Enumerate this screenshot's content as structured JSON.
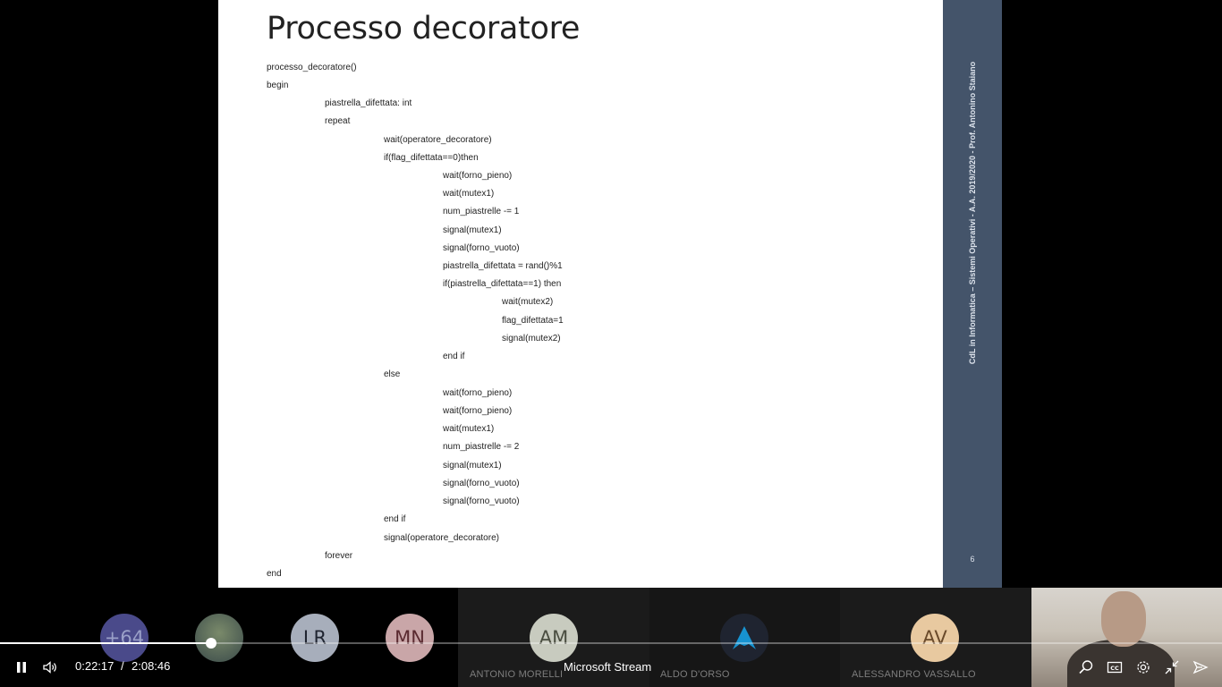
{
  "slide": {
    "title": "Processo decoratore",
    "lines": [
      "processo_decoratore()",
      "begin",
      "piastrella_difettata: int",
      "repeat",
      "wait(operatore_decoratore)",
      "if(flag_difettata==0)then",
      "wait(forno_pieno)",
      "wait(mutex1)",
      "num_piastrelle -= 1",
      "signal(mutex1)",
      "signal(forno_vuoto)",
      "piastrella_difettata = rand()%1",
      "if(piastrella_difettata==1) then",
      "wait(mutex2)",
      "flag_difettata=1",
      "signal(mutex2)",
      "end if",
      "else",
      "wait(forno_pieno)",
      "wait(forno_pieno)",
      "wait(mutex1)",
      "num_piastrelle -= 2",
      "signal(mutex1)",
      "signal(forno_vuoto)",
      "signal(forno_vuoto)",
      "end if",
      "signal(operatore_decoratore)",
      "forever",
      "end"
    ],
    "side_caption": "CdL in Informatica – Sistemi Operativi - A.A. 2019/2020 - Prof. Antonino Staiano",
    "page_number": "6",
    "band_color": "#44546a"
  },
  "participants": [
    {
      "initials": "+64",
      "name": "",
      "color": "#4a4a8a"
    },
    {
      "initials": "",
      "name": "",
      "color": "#5a6a6a"
    },
    {
      "initials": "LR",
      "name": "",
      "color": "#a7aebb"
    },
    {
      "initials": "MN",
      "name": "",
      "color": "#c9a6a8"
    },
    {
      "initials": "AM",
      "name": "ANTONIO MORELLI",
      "color": "#c8cbbf"
    },
    {
      "initials": "",
      "name": "ALDO D'ORSO",
      "color": "#1f2430"
    },
    {
      "initials": "AV",
      "name": "ALESSANDRO VASSALLO",
      "color": "#e8c9a0"
    }
  ],
  "player": {
    "current_time": "0:22:17",
    "separator": "/",
    "total_time": "2:08:46",
    "brand": "Microsoft Stream",
    "progress": 0.1731
  },
  "icons": [
    "pause-icon",
    "volume-icon",
    "search-icon",
    "captions-icon",
    "settings-icon",
    "collapse-icon",
    "share-icon"
  ]
}
